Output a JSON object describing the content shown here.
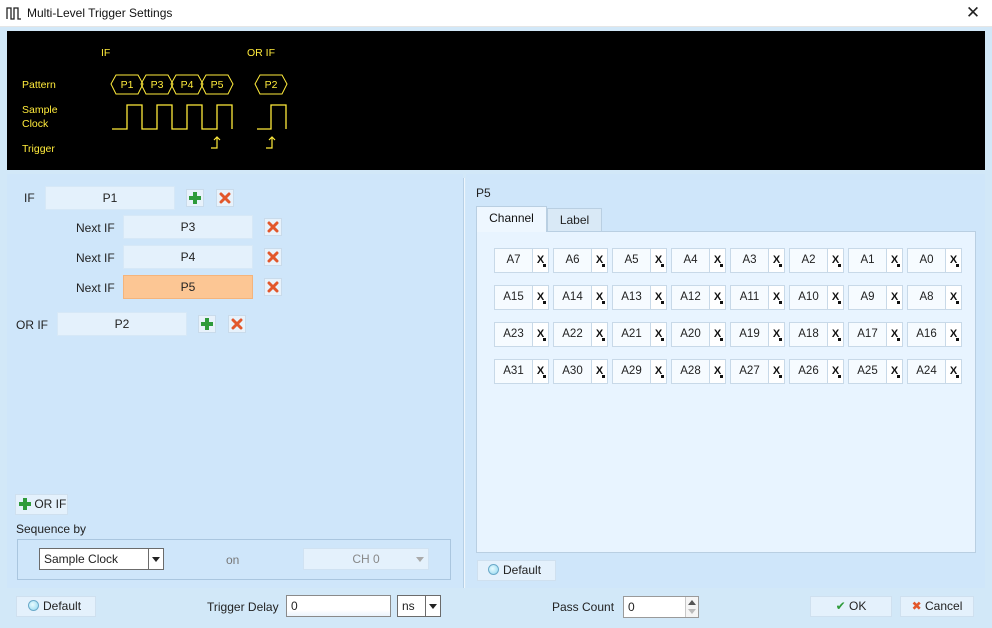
{
  "window": {
    "title": "Multi-Level Trigger Settings"
  },
  "waveform": {
    "if_label": "IF",
    "or_if_label": "OR IF",
    "row_pattern": "Pattern",
    "row_sample_1": "Sample",
    "row_sample_2": "Clock",
    "row_trigger": "Trigger",
    "if_patterns": [
      "P1",
      "P3",
      "P4",
      "P5"
    ],
    "or_patterns": [
      "P2"
    ],
    "color": "#ffeb3b"
  },
  "conditions": {
    "if_label": "IF",
    "if_value": "P1",
    "next_label": "Next IF",
    "next_values": [
      "P3",
      "P4",
      "P5"
    ],
    "or_if_label": "OR IF",
    "or_if_value": "P2",
    "selected_value": "P5",
    "selected_color": "#fcc694"
  },
  "add_or_if": "OR IF",
  "sequence": {
    "label": "Sequence by",
    "source": "Sample Clock",
    "on_label": "on",
    "channel": "CH 0"
  },
  "footer": {
    "default_label": "Default",
    "trigger_delay_label": "Trigger Delay",
    "trigger_delay_value": "0",
    "trigger_delay_unit": "ns",
    "pass_count_label": "Pass Count",
    "pass_count_value": "0",
    "ok_label": "OK",
    "cancel_label": "Cancel"
  },
  "pattern_editor": {
    "title": "P5",
    "tabs": [
      "Channel",
      "Label"
    ],
    "active_tab": "Channel",
    "channel_rows": [
      [
        "A7",
        "A6",
        "A5",
        "A4",
        "A3",
        "A2",
        "A1",
        "A0"
      ],
      [
        "A15",
        "A14",
        "A13",
        "A12",
        "A11",
        "A10",
        "A9",
        "A8"
      ],
      [
        "A23",
        "A22",
        "A21",
        "A20",
        "A19",
        "A18",
        "A17",
        "A16"
      ],
      [
        "A31",
        "A30",
        "A29",
        "A28",
        "A27",
        "A26",
        "A25",
        "A24"
      ]
    ],
    "state_symbol": "X",
    "default_label": "Default"
  }
}
